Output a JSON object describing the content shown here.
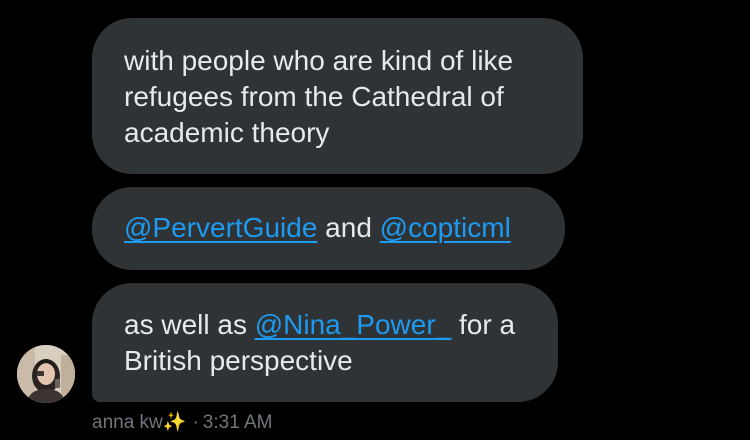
{
  "messages": [
    {
      "text": "with people who are kind of like refugees from the Cathedral of academic theory"
    },
    {
      "mention1": "@PervertGuide",
      "middle": " and ",
      "mention2": "@copticml"
    },
    {
      "before": "as well as ",
      "mention": "@Nina_Power_",
      "after": " for a British perspective"
    }
  ],
  "sender": {
    "name": "anna kw",
    "emoji": "✨",
    "separator": "·",
    "time": "3:31 AM"
  },
  "colors": {
    "background": "#000000",
    "bubble": "#2f3336",
    "text": "#e7e9ea",
    "link": "#1d9bf0",
    "meta": "#71767b"
  }
}
